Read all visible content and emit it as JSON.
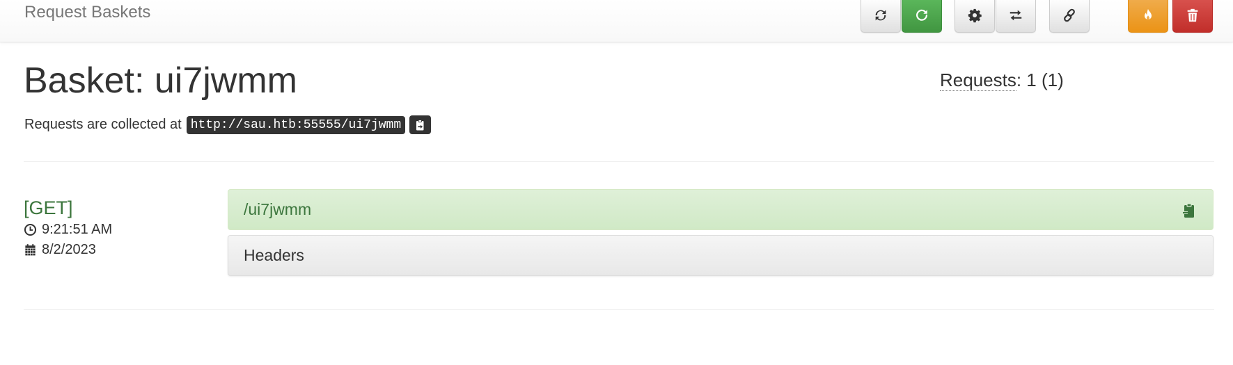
{
  "app": {
    "title": "Request Baskets"
  },
  "toolbar": {
    "buttons": [
      {
        "name": "refresh-button",
        "icon": "refresh-icon"
      },
      {
        "name": "auto-refresh-button",
        "icon": "auto-refresh-icon",
        "color": "#5cb85c"
      },
      {
        "name": "settings-button",
        "icon": "gear-icon"
      },
      {
        "name": "responses-button",
        "icon": "exchange-icon"
      },
      {
        "name": "share-link-button",
        "icon": "link-icon"
      },
      {
        "name": "clear-requests-button",
        "icon": "fire-icon",
        "color": "#f0ad4e"
      },
      {
        "name": "delete-basket-button",
        "icon": "trash-icon",
        "color": "#d9534f"
      }
    ]
  },
  "basket": {
    "title": "Basket: ui7jwmm",
    "requests_label": "Requests",
    "requests_value": ": 1 (1)",
    "collected_prefix": "Requests are collected at",
    "url": "http://sau.htb:55555/ui7jwmm"
  },
  "request": {
    "method": "[GET]",
    "time": "9:21:51 AM",
    "date": "8/2/2023",
    "path": "/ui7jwmm",
    "headers_label": "Headers"
  },
  "colors": {
    "success_text": "#3c763d",
    "success_bg": "#dff0d8",
    "code_bg": "#333333"
  }
}
